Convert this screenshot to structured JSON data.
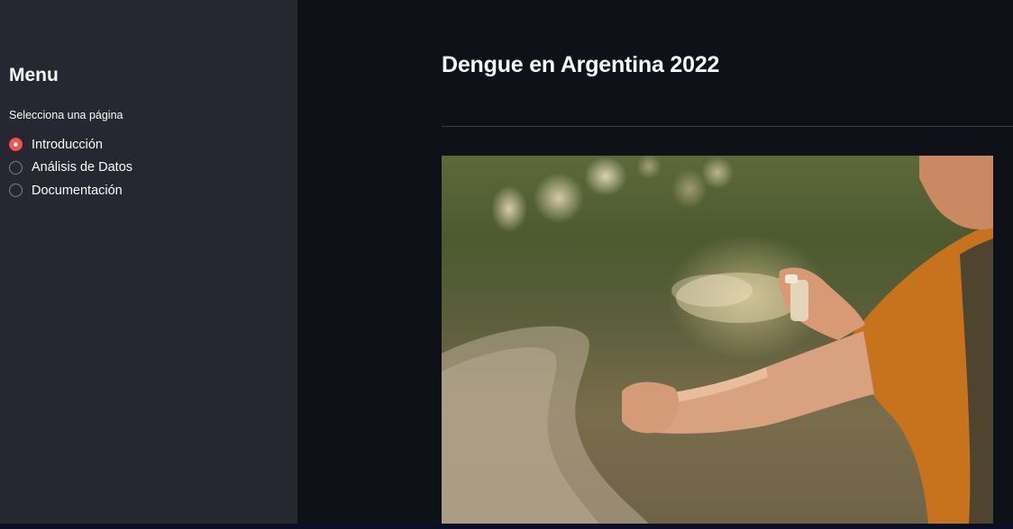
{
  "sidebar": {
    "title": "Menu",
    "radio_caption": "Selecciona una página",
    "options": [
      {
        "label": "Introducción",
        "selected": true
      },
      {
        "label": "Análisis de Datos",
        "selected": false
      },
      {
        "label": "Documentación",
        "selected": false
      }
    ]
  },
  "main": {
    "title": "Dengue en Argentina 2022"
  },
  "colors": {
    "accent": "#ff4b4b",
    "background": "#0e1117",
    "sidebar_background": "#262730",
    "text": "#fafafa"
  }
}
